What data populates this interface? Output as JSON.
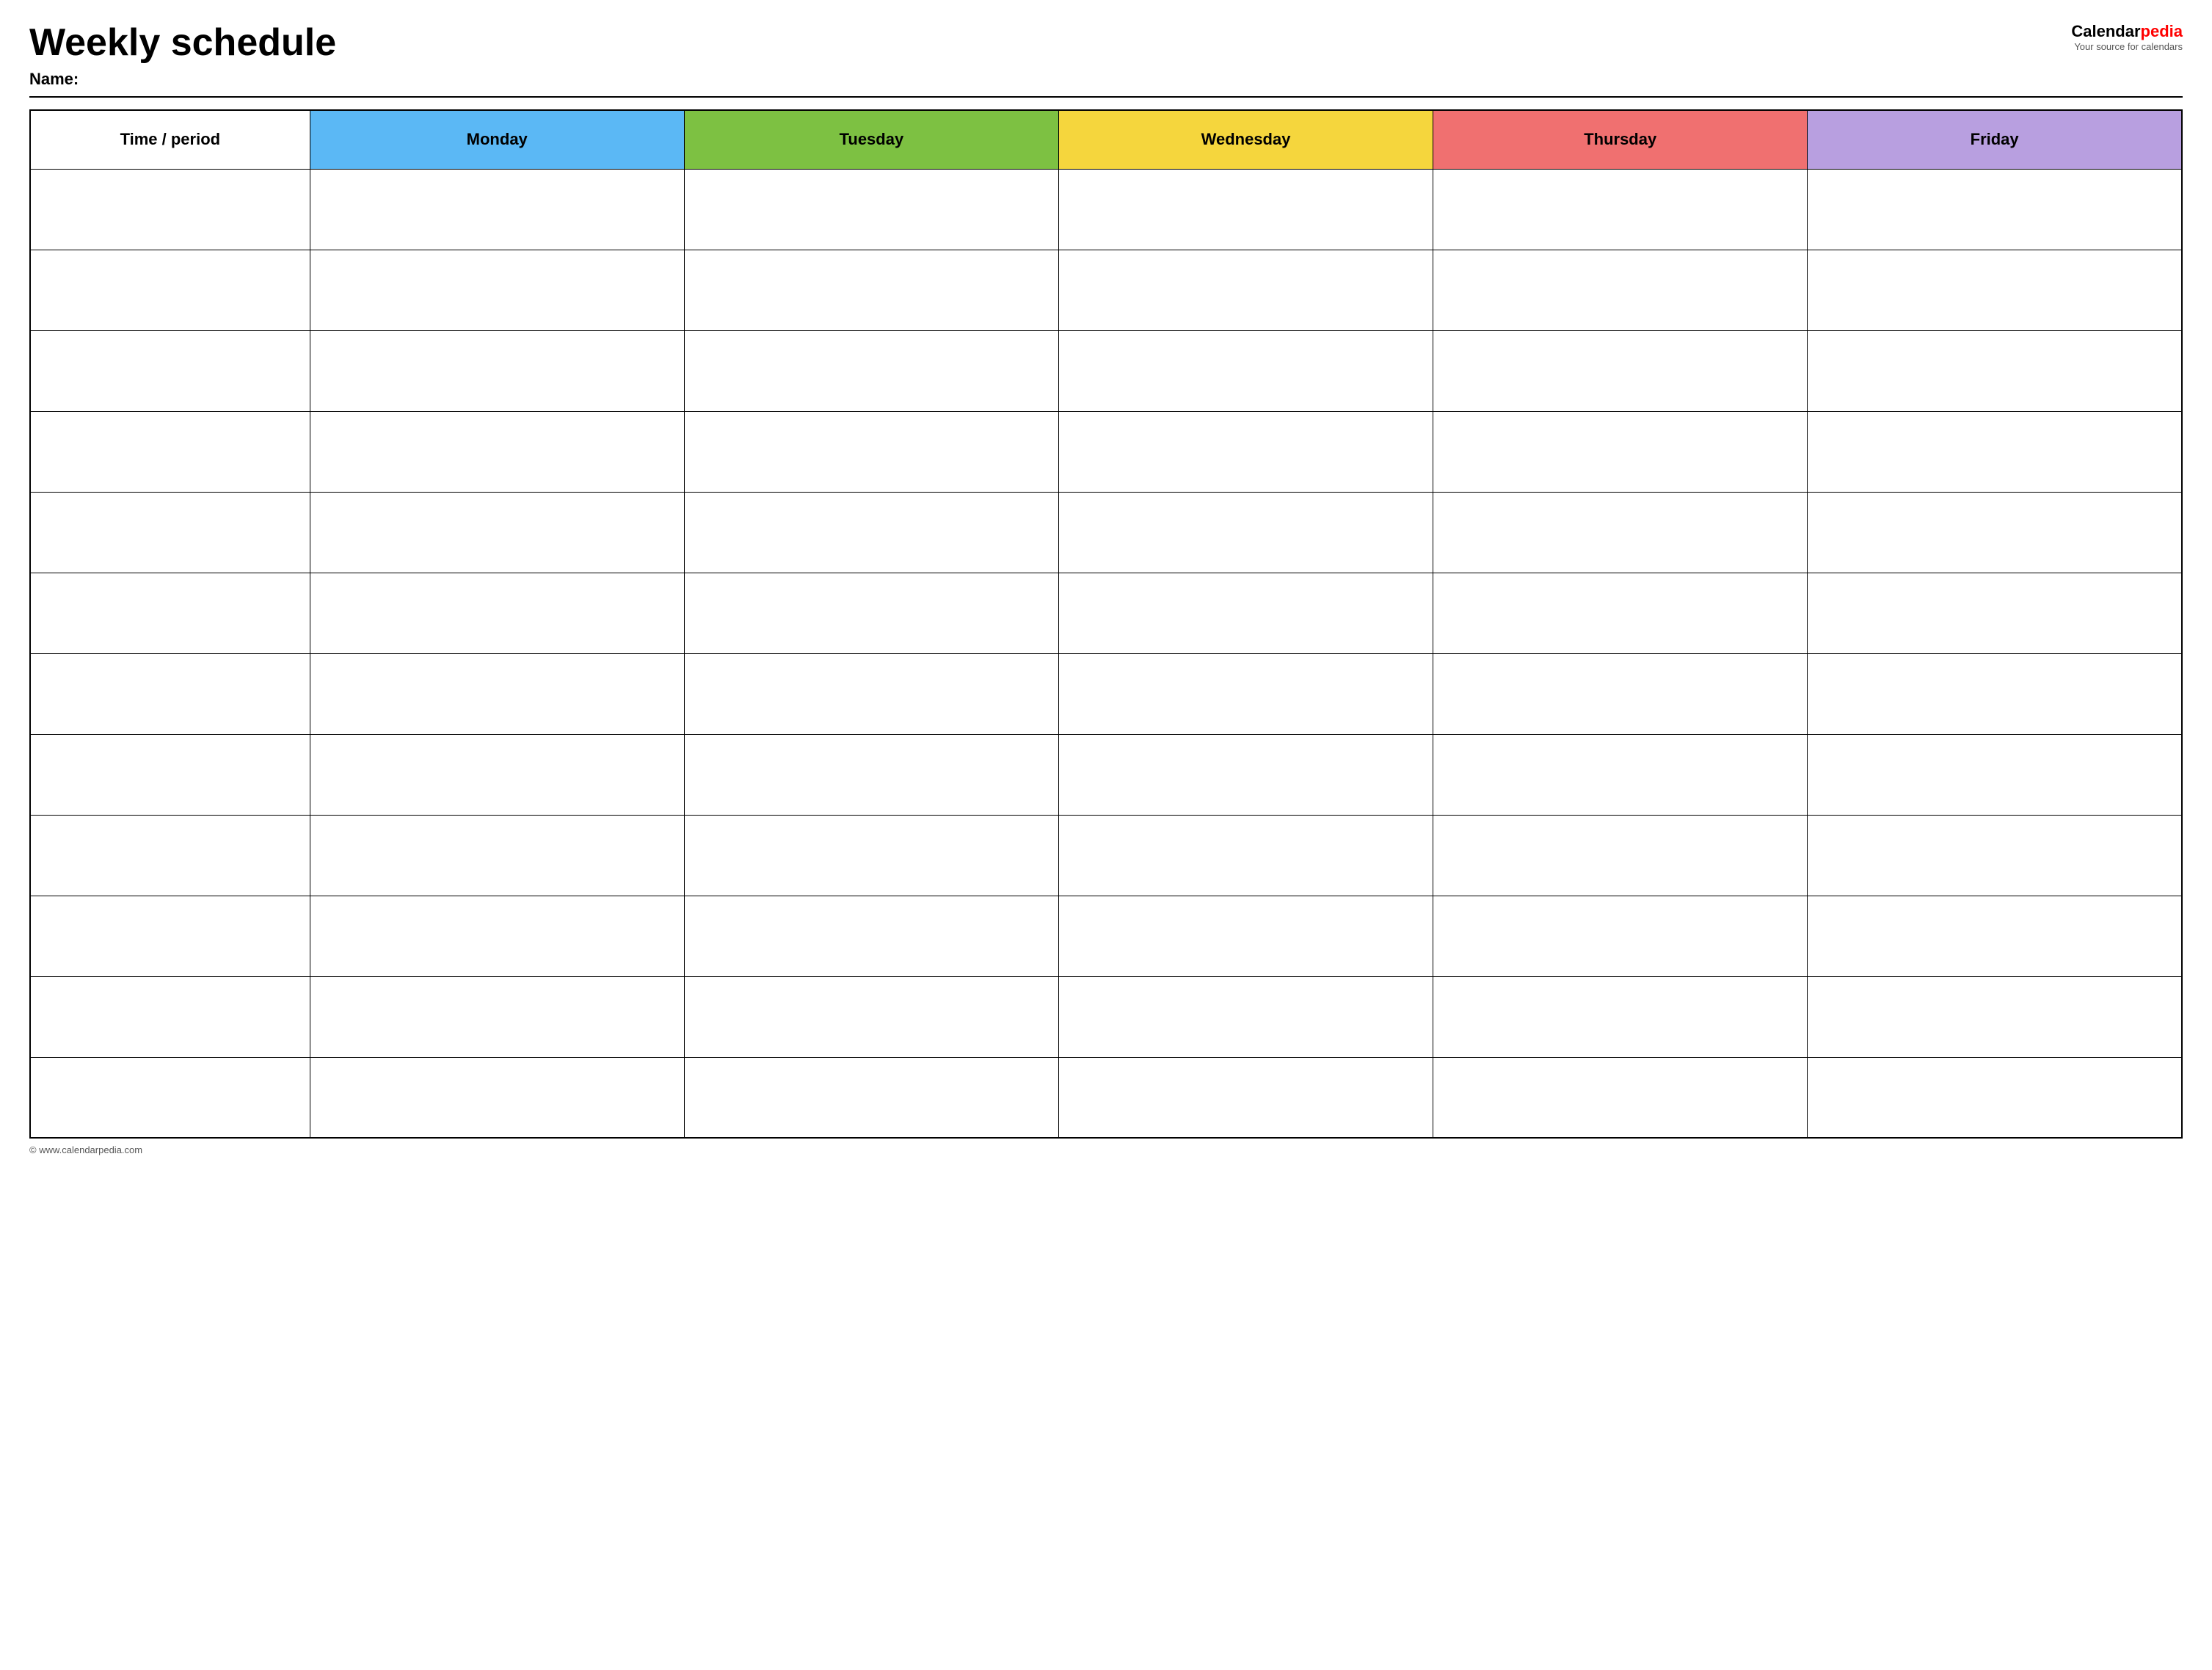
{
  "header": {
    "title": "Weekly schedule",
    "name_label": "Name:",
    "logo_text_black": "Calendar",
    "logo_text_red": "pedia",
    "logo_tagline": "Your source for calendars"
  },
  "table": {
    "columns": [
      {
        "id": "time",
        "label": "Time / period",
        "color": "#ffffff"
      },
      {
        "id": "monday",
        "label": "Monday",
        "color": "#5bb8f5"
      },
      {
        "id": "tuesday",
        "label": "Tuesday",
        "color": "#7dc142"
      },
      {
        "id": "wednesday",
        "label": "Wednesday",
        "color": "#f5d63d"
      },
      {
        "id": "thursday",
        "label": "Thursday",
        "color": "#f07070"
      },
      {
        "id": "friday",
        "label": "Friday",
        "color": "#b89fe0"
      }
    ],
    "row_count": 12
  },
  "footer": {
    "copyright": "© www.calendarpedia.com"
  }
}
